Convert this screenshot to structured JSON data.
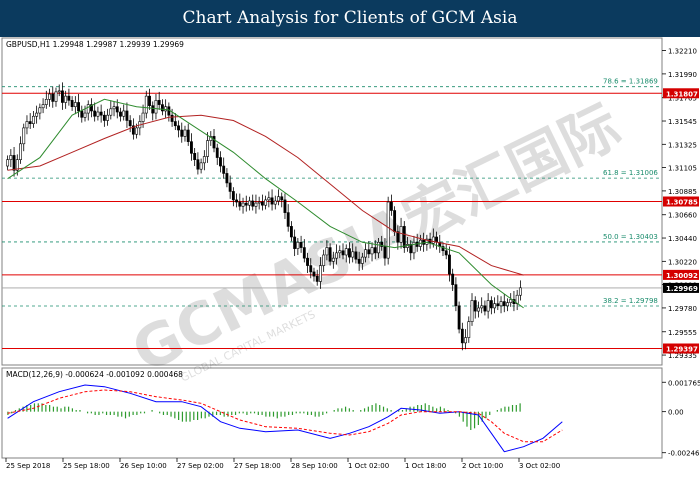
{
  "banner": {
    "title": "Chart Analysis for Clients of GCM Asia"
  },
  "watermark": {
    "text": "GCMASIA宏汇国际",
    "subtext": "GLOBAL CAPITAL MARKETS"
  },
  "colors": {
    "banner": "#0b3a5e",
    "candles": "#000000",
    "ma_fast": "#2e8b2e",
    "ma_slow": "#b22222",
    "sr_line": "#e00000",
    "fib_line": "#1a8c6c",
    "price_box": "#d40000",
    "current_box": "#000000",
    "macd_hist": "#2e9b2e",
    "macd_line": "#0000ff",
    "signal_line": "#ff0000"
  },
  "chart_data": {
    "type": "candlestick",
    "symbol_header": "GBPUSD,H1  1.29948 1.29987 1.29939 1.29969",
    "price_axis": {
      "range": [
        1.2926,
        1.3231
      ],
      "ticks": [
        "1.32210",
        "1.31990",
        "1.31765",
        "1.31545",
        "1.31325",
        "1.31105",
        "1.30885",
        "1.30660",
        "1.30440",
        "1.30220",
        "1.30000",
        "1.29780",
        "1.29555",
        "1.29335"
      ]
    },
    "time_labels": [
      "25 Sep 2018",
      "25 Sep 18:00",
      "26 Sep 10:00",
      "27 Sep 02:00",
      "27 Sep 18:00",
      "28 Sep 10:00",
      "1 Oct 02:00",
      "1 Oct 18:00",
      "2 Oct 10:00",
      "3 Oct 02:00"
    ],
    "support_resistance": [
      "1.31807",
      "1.30785",
      "1.30092",
      "1.29397"
    ],
    "fibonacci": [
      {
        "label": "78.6 = 1.31869",
        "value": 1.31869
      },
      {
        "label": "61.8 = 1.31006",
        "value": 1.31006
      },
      {
        "label": "50.0 = 1.30403",
        "value": 1.30403
      },
      {
        "label": "38.2 = 1.29798",
        "value": 1.29798
      }
    ],
    "current_price": "1.29969",
    "candle_closes": [
      1.3118,
      1.3122,
      1.3108,
      1.3118,
      1.3133,
      1.3148,
      1.3154,
      1.3152,
      1.3159,
      1.3162,
      1.3167,
      1.317,
      1.3175,
      1.318,
      1.3173,
      1.3182,
      1.3183,
      1.3172,
      1.3178,
      1.3174,
      1.3168,
      1.3172,
      1.3164,
      1.3158,
      1.3162,
      1.317,
      1.3164,
      1.3159,
      1.3163,
      1.316,
      1.3155,
      1.316,
      1.3166,
      1.3168,
      1.3163,
      1.3159,
      1.3164,
      1.3155,
      1.315,
      1.3142,
      1.3148,
      1.3154,
      1.3162,
      1.3178,
      1.3169,
      1.3162,
      1.3174,
      1.317,
      1.3164,
      1.3168,
      1.316,
      1.3154,
      1.315,
      1.3146,
      1.314,
      1.3146,
      1.3135,
      1.3124,
      1.3118,
      1.3109,
      1.3115,
      1.3121,
      1.3136,
      1.314,
      1.3129,
      1.312,
      1.3112,
      1.3105,
      1.3096,
      1.3088,
      1.308,
      1.3078,
      1.3074,
      1.3077,
      1.3075,
      1.3079,
      1.3074,
      1.3077,
      1.3078,
      1.3075,
      1.308,
      1.3082,
      1.3076,
      1.3079,
      1.3083,
      1.308,
      1.3068,
      1.3055,
      1.3045,
      1.3034,
      1.304,
      1.3035,
      1.3025,
      1.3018,
      1.3012,
      1.3008,
      1.3003,
      1.3018,
      1.3028,
      1.3035,
      1.3022,
      1.3025,
      1.303,
      1.3032,
      1.3028,
      1.3034,
      1.3026,
      1.3031,
      1.3024,
      1.302,
      1.3026,
      1.3033,
      1.3029,
      1.3035,
      1.303,
      1.304,
      1.3036,
      1.3025,
      1.3078,
      1.307,
      1.305,
      1.304,
      1.3055,
      1.3035,
      1.3038,
      1.303,
      1.304,
      1.3036,
      1.3042,
      1.3038,
      1.3043,
      1.3039,
      1.3045,
      1.304,
      1.3036,
      1.3032,
      1.3028,
      1.301,
      1.3,
      1.298,
      1.2958,
      1.2945,
      1.295,
      1.2965,
      1.2985,
      1.2975,
      1.2978,
      1.298,
      1.2975,
      1.2985,
      1.2978,
      1.2982,
      1.298,
      1.2984,
      1.298,
      1.2983,
      1.2986,
      1.2982,
      1.299,
      1.2997
    ],
    "ma_fast": [
      [
        0,
        1.31
      ],
      [
        10,
        1.312
      ],
      [
        20,
        1.316
      ],
      [
        30,
        1.3175
      ],
      [
        40,
        1.3168
      ],
      [
        50,
        1.3165
      ],
      [
        60,
        1.3145
      ],
      [
        70,
        1.3125
      ],
      [
        80,
        1.31
      ],
      [
        90,
        1.3078
      ],
      [
        100,
        1.3055
      ],
      [
        110,
        1.304
      ],
      [
        120,
        1.3035
      ],
      [
        130,
        1.304
      ],
      [
        140,
        1.303
      ],
      [
        150,
        1.3
      ],
      [
        160,
        1.2978
      ]
    ],
    "ma_slow": [
      [
        0,
        1.3108
      ],
      [
        10,
        1.3112
      ],
      [
        20,
        1.3125
      ],
      [
        30,
        1.3138
      ],
      [
        40,
        1.315
      ],
      [
        50,
        1.3158
      ],
      [
        60,
        1.316
      ],
      [
        70,
        1.3155
      ],
      [
        80,
        1.314
      ],
      [
        90,
        1.312
      ],
      [
        100,
        1.3095
      ],
      [
        110,
        1.307
      ],
      [
        120,
        1.305
      ],
      [
        130,
        1.3042
      ],
      [
        140,
        1.3036
      ],
      [
        150,
        1.3018
      ],
      [
        160,
        1.3009
      ]
    ],
    "macd": {
      "label": "MACD(12,26,9) -0.000624 -0.001092 0.000468",
      "range": [
        -0.0026,
        0.0019
      ],
      "ticks": [
        "0.001765",
        "0.00",
        "-0.002463"
      ],
      "histogram": [
        -0.0002,
        -0.0001,
        0.0001,
        0.0002,
        0.0003,
        0.0004,
        0.0004,
        0.0005,
        0.0005,
        0.0005,
        0.0004,
        0.0004,
        0.0003,
        0.0003,
        0.0002,
        0.0003,
        0.0003,
        0.0002,
        0.0001,
        0.0001,
        0.0,
        -0.0001,
        -0.0001,
        -0.0002,
        -0.0002,
        -0.0001,
        -0.0002,
        -0.0002,
        -0.0002,
        -0.0003,
        -0.0003,
        -0.0004,
        -0.0003,
        -0.0002,
        -0.0002,
        -0.0001,
        -0.0001,
        0.0,
        0.0001,
        0.0,
        -0.0001,
        -0.0002,
        -0.0002,
        -0.0003,
        -0.0004,
        -0.0005,
        -0.0006,
        -0.0006,
        -0.0006,
        -0.0005,
        -0.0005,
        -0.0004,
        -0.0004,
        -0.0003,
        -0.0003,
        -0.0002,
        -0.0002,
        -0.0003,
        -0.0003,
        -0.0002,
        -0.0002,
        -0.0001,
        -0.0001,
        -0.0002,
        -0.0001,
        -0.0001,
        -0.0002,
        -0.0002,
        -0.0003,
        -0.0003,
        -0.0003,
        -0.0004,
        -0.0003,
        -0.0003,
        -0.0002,
        -0.0002,
        -0.0001,
        -0.0001,
        -0.0001,
        -0.0002,
        -0.0002,
        -0.0003,
        -0.0003,
        -0.0002,
        -0.0001,
        0.0,
        0.0001,
        0.0002,
        0.0002,
        0.0003,
        0.0002,
        0.0001,
        0.0,
        0.0001,
        0.0002,
        0.0003,
        0.0004,
        0.0005,
        0.0004,
        0.0003,
        0.0002,
        0.0001,
        0.0,
        0.0001,
        0.0001,
        0.0002,
        0.0003,
        0.0003,
        0.0004,
        0.0004,
        0.0005,
        0.0004,
        0.0003,
        0.0002,
        0.0003,
        0.0002,
        0.0001,
        0.0,
        -0.0001,
        -0.0003,
        -0.0006,
        -0.0009,
        -0.0011,
        -0.001,
        -0.0008,
        -0.0006,
        -0.0004,
        -0.0002,
        0.0,
        0.0001,
        0.0002,
        0.0003,
        0.0003,
        0.0004,
        0.0004,
        0.0005
      ],
      "macd_line": [
        [
          0,
          -0.0004
        ],
        [
          8,
          0.0006
        ],
        [
          16,
          0.0012
        ],
        [
          24,
          0.0016
        ],
        [
          30,
          0.0015
        ],
        [
          38,
          0.0011
        ],
        [
          46,
          0.0006
        ],
        [
          54,
          0.0006
        ],
        [
          60,
          0.0003
        ],
        [
          66,
          -0.0006
        ],
        [
          72,
          -0.001
        ],
        [
          80,
          -0.0012
        ],
        [
          90,
          -0.0011
        ],
        [
          100,
          -0.0016
        ],
        [
          106,
          -0.0013
        ],
        [
          112,
          -0.0009
        ],
        [
          118,
          -0.0003
        ],
        [
          122,
          0.0002
        ],
        [
          128,
          0.0001
        ],
        [
          134,
          -0.0001
        ],
        [
          140,
          0.0
        ],
        [
          146,
          -0.0002
        ],
        [
          150,
          -0.0013
        ],
        [
          154,
          -0.0024
        ],
        [
          160,
          -0.0021
        ],
        [
          166,
          -0.0016
        ],
        [
          172,
          -0.0006
        ]
      ],
      "signal_line": [
        [
          0,
          -0.0001
        ],
        [
          8,
          0.0002
        ],
        [
          16,
          0.0008
        ],
        [
          24,
          0.0012
        ],
        [
          30,
          0.0013
        ],
        [
          38,
          0.0012
        ],
        [
          46,
          0.0009
        ],
        [
          54,
          0.0007
        ],
        [
          60,
          0.0005
        ],
        [
          66,
          0.0
        ],
        [
          72,
          -0.0005
        ],
        [
          80,
          -0.0009
        ],
        [
          90,
          -0.001
        ],
        [
          100,
          -0.0013
        ],
        [
          106,
          -0.0014
        ],
        [
          112,
          -0.0012
        ],
        [
          118,
          -0.0007
        ],
        [
          122,
          -0.0002
        ],
        [
          128,
          0.0
        ],
        [
          134,
          0.0
        ],
        [
          140,
          0.0
        ],
        [
          146,
          -0.0001
        ],
        [
          150,
          -0.0006
        ],
        [
          154,
          -0.0013
        ],
        [
          160,
          -0.0018
        ],
        [
          166,
          -0.0018
        ],
        [
          172,
          -0.0011
        ]
      ]
    }
  }
}
